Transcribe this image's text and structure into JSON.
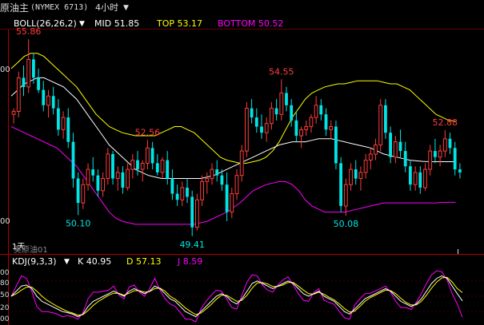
{
  "header": {
    "instrument": "原油主",
    "code": "(NYMEX 6713)",
    "period": "4小时",
    "period_dropdown_icon": "chevron-down-icon"
  },
  "boll_legend": {
    "name": "BOLL(26,26,2)",
    "mid": "MID 51.85",
    "top": "TOP 53.17",
    "bottom": "BOTTOM 50.52",
    "colors": {
      "mid": "#ffffff",
      "top": "#ffff00",
      "bottom": "#ff00ff",
      "name": "#ffffff"
    }
  },
  "kdj_legend": {
    "name": "KDJ(9,3,3)",
    "k": "K 40.95",
    "d": "D 57.13",
    "j": "J 8.59",
    "colors": {
      "k": "#ffffff",
      "d": "#ffff00",
      "j": "#ff00ff"
    }
  },
  "y_axis_labels": {
    "upper": "00",
    "lower": "00"
  },
  "kdj_axis_labels": [
    "00",
    "80",
    "50",
    "20",
    "00"
  ],
  "annotations": [
    {
      "text": "55.86",
      "kind": "high"
    },
    {
      "text": "54.55",
      "kind": "high"
    },
    {
      "text": "52.56",
      "kind": "high"
    },
    {
      "text": "52.88",
      "kind": "high"
    },
    {
      "text": "50.10",
      "kind": "low"
    },
    {
      "text": "49.41",
      "kind": "low"
    },
    {
      "text": "50.08",
      "kind": "low"
    }
  ],
  "footer_label": "1天",
  "contract_tag": "美原油01",
  "colors": {
    "up": "#ff3c3c",
    "down": "#00e5e5",
    "high_label": "#ff3c3c",
    "low_label": "#00e5e5",
    "axis": "#b00000"
  },
  "chart_data": {
    "type": "candlestick",
    "price_range": [
      49.3,
      56.1
    ],
    "candles": [
      [
        53.4,
        53.6,
        53.1,
        53.5
      ],
      [
        53.5,
        54.8,
        53.3,
        54.6
      ],
      [
        54.6,
        55.0,
        54.0,
        54.3
      ],
      [
        54.3,
        55.86,
        54.1,
        55.2
      ],
      [
        55.2,
        55.4,
        54.4,
        54.6
      ],
      [
        54.6,
        54.9,
        54.1,
        54.2
      ],
      [
        54.2,
        54.5,
        53.5,
        53.7
      ],
      [
        53.7,
        54.2,
        53.3,
        54.0
      ],
      [
        54.0,
        54.3,
        53.4,
        53.6
      ],
      [
        53.6,
        53.9,
        52.7,
        52.9
      ],
      [
        52.9,
        53.5,
        52.6,
        53.3
      ],
      [
        53.3,
        53.6,
        52.3,
        52.5
      ],
      [
        52.5,
        52.8,
        51.0,
        51.3
      ],
      [
        51.3,
        51.5,
        50.1,
        50.5
      ],
      [
        50.5,
        51.3,
        50.3,
        51.1
      ],
      [
        51.1,
        51.8,
        50.9,
        51.6
      ],
      [
        51.6,
        52.0,
        51.2,
        51.4
      ],
      [
        51.4,
        51.6,
        50.7,
        50.9
      ],
      [
        50.9,
        51.5,
        50.7,
        51.3
      ],
      [
        51.3,
        52.3,
        51.1,
        52.1
      ],
      [
        52.1,
        52.2,
        51.1,
        51.3
      ],
      [
        51.3,
        51.7,
        50.9,
        51.5
      ],
      [
        51.5,
        51.7,
        50.8,
        51.0
      ],
      [
        51.0,
        51.8,
        50.9,
        51.6
      ],
      [
        51.6,
        52.1,
        51.3,
        51.9
      ],
      [
        51.9,
        52.2,
        51.4,
        51.6
      ],
      [
        51.6,
        51.9,
        51.2,
        51.8
      ],
      [
        51.8,
        52.56,
        51.6,
        52.3
      ],
      [
        52.3,
        52.5,
        51.6,
        51.8
      ],
      [
        51.8,
        52.1,
        51.4,
        51.5
      ],
      [
        51.5,
        52.0,
        51.3,
        51.9
      ],
      [
        51.9,
        52.2,
        51.1,
        51.3
      ],
      [
        51.3,
        51.6,
        50.6,
        50.8
      ],
      [
        50.8,
        51.1,
        50.4,
        50.6
      ],
      [
        50.6,
        51.2,
        50.4,
        51.0
      ],
      [
        51.0,
        51.3,
        50.5,
        50.7
      ],
      [
        50.7,
        50.9,
        49.41,
        49.7
      ],
      [
        49.7,
        50.8,
        49.6,
        50.6
      ],
      [
        50.6,
        51.4,
        50.4,
        51.2
      ],
      [
        51.2,
        51.5,
        50.8,
        51.3
      ],
      [
        51.3,
        51.8,
        51.1,
        51.6
      ],
      [
        51.6,
        51.9,
        51.2,
        51.4
      ],
      [
        51.4,
        51.6,
        50.9,
        51.1
      ],
      [
        51.1,
        51.5,
        49.9,
        50.2
      ],
      [
        50.2,
        51.0,
        50.0,
        50.8
      ],
      [
        50.8,
        51.6,
        50.6,
        51.4
      ],
      [
        51.4,
        52.4,
        51.2,
        52.2
      ],
      [
        52.2,
        53.8,
        52.0,
        53.6
      ],
      [
        53.6,
        53.9,
        53.1,
        53.3
      ],
      [
        53.3,
        53.6,
        52.8,
        53.0
      ],
      [
        53.0,
        53.4,
        52.6,
        52.8
      ],
      [
        52.8,
        53.3,
        52.5,
        53.1
      ],
      [
        53.1,
        53.8,
        52.9,
        53.6
      ],
      [
        53.6,
        53.9,
        53.2,
        53.4
      ],
      [
        53.4,
        54.55,
        53.2,
        54.1
      ],
      [
        54.1,
        54.3,
        53.5,
        53.7
      ],
      [
        53.7,
        53.9,
        53.0,
        53.2
      ],
      [
        53.2,
        53.5,
        52.5,
        52.7
      ],
      [
        52.7,
        53.0,
        52.3,
        52.9
      ],
      [
        52.9,
        53.2,
        52.7,
        53.0
      ],
      [
        53.0,
        53.4,
        52.8,
        53.3
      ],
      [
        53.3,
        54.0,
        53.1,
        53.7
      ],
      [
        53.7,
        53.9,
        53.2,
        53.4
      ],
      [
        53.4,
        53.6,
        52.7,
        52.9
      ],
      [
        52.9,
        53.2,
        52.6,
        53.0
      ],
      [
        53.0,
        53.2,
        51.6,
        51.8
      ],
      [
        51.8,
        52.0,
        50.2,
        50.4
      ],
      [
        50.4,
        51.3,
        50.08,
        51.1
      ],
      [
        51.1,
        51.8,
        50.9,
        51.6
      ],
      [
        51.6,
        51.9,
        51.1,
        51.3
      ],
      [
        51.3,
        51.7,
        50.9,
        51.5
      ],
      [
        51.5,
        52.1,
        51.3,
        51.9
      ],
      [
        51.9,
        52.3,
        51.6,
        52.1
      ],
      [
        52.1,
        52.6,
        51.9,
        52.4
      ],
      [
        52.4,
        53.9,
        52.2,
        53.7
      ],
      [
        53.7,
        53.9,
        52.6,
        52.8
      ],
      [
        52.8,
        53.0,
        51.8,
        52.0
      ],
      [
        52.0,
        52.7,
        51.8,
        52.5
      ],
      [
        52.5,
        52.9,
        52.0,
        52.2
      ],
      [
        52.2,
        52.5,
        51.5,
        51.7
      ],
      [
        51.7,
        51.9,
        50.9,
        51.1
      ],
      [
        51.1,
        51.7,
        50.9,
        51.5
      ],
      [
        51.5,
        51.7,
        50.8,
        51.0
      ],
      [
        51.0,
        51.8,
        50.9,
        51.6
      ],
      [
        51.6,
        52.4,
        51.4,
        52.2
      ],
      [
        52.2,
        52.6,
        51.8,
        52.0
      ],
      [
        52.0,
        52.4,
        51.7,
        52.2
      ],
      [
        52.2,
        52.88,
        52.0,
        52.6
      ],
      [
        52.6,
        52.8,
        52.1,
        52.3
      ],
      [
        52.3,
        52.5,
        51.4,
        51.6
      ],
      [
        51.6,
        51.8,
        51.3,
        51.5
      ]
    ],
    "boll_top": [
      54.9,
      55.1,
      55.3,
      55.4,
      55.4,
      55.3,
      55.1,
      54.9,
      54.7,
      54.5,
      54.3,
      54.0,
      53.7,
      53.4,
      53.2,
      53.0,
      52.9,
      52.8,
      52.75,
      52.7,
      52.7,
      52.7,
      52.7,
      52.8,
      52.9,
      53.0,
      53.0,
      52.9,
      52.8,
      52.6,
      52.4,
      52.2,
      52.0,
      51.9,
      51.85,
      51.8,
      51.8,
      51.85,
      51.9,
      52.0,
      52.2,
      52.5,
      52.9,
      53.3,
      53.6,
      53.9,
      54.1,
      54.2,
      54.3,
      54.35,
      54.4,
      54.4,
      54.45,
      54.5,
      54.5,
      54.5,
      54.5,
      54.45,
      54.4,
      54.4,
      54.3,
      54.2,
      54.0,
      53.8,
      53.6,
      53.4,
      53.3,
      53.2,
      53.17
    ],
    "boll_mid": [
      54.0,
      54.2,
      54.4,
      54.5,
      54.6,
      54.6,
      54.5,
      54.4,
      54.3,
      54.1,
      53.9,
      53.6,
      53.3,
      53.0,
      52.7,
      52.4,
      52.2,
      52.0,
      51.8,
      51.6,
      51.5,
      51.4,
      51.35,
      51.3,
      51.3,
      51.3,
      51.3,
      51.3,
      51.3,
      51.3,
      51.35,
      51.4,
      51.5,
      51.6,
      51.7,
      51.8,
      51.9,
      52.0,
      52.1,
      52.2,
      52.3,
      52.4,
      52.45,
      52.5,
      52.5,
      52.5,
      52.55,
      52.6,
      52.6,
      52.6,
      52.55,
      52.5,
      52.45,
      52.4,
      52.35,
      52.3,
      52.2,
      52.1,
      52.05,
      52.0,
      51.95,
      51.9,
      51.88,
      51.86,
      51.85,
      51.85,
      51.85,
      51.85,
      51.85
    ],
    "boll_bottom": [
      53.0,
      52.9,
      52.8,
      52.7,
      52.6,
      52.5,
      52.4,
      52.3,
      52.1,
      51.9,
      51.7,
      51.4,
      51.1,
      50.8,
      50.5,
      50.2,
      50.0,
      49.9,
      49.85,
      49.8,
      49.8,
      49.8,
      49.8,
      49.8,
      49.8,
      49.8,
      49.8,
      49.8,
      49.8,
      49.85,
      49.9,
      50.0,
      50.1,
      50.2,
      50.35,
      50.5,
      50.7,
      50.9,
      51.0,
      51.1,
      51.15,
      51.2,
      51.2,
      51.1,
      50.9,
      50.6,
      50.4,
      50.3,
      50.2,
      50.2,
      50.2,
      50.2,
      50.25,
      50.3,
      50.35,
      50.4,
      50.45,
      50.5,
      50.5,
      50.5,
      50.5,
      50.5,
      50.5,
      50.5,
      50.5,
      50.5,
      50.52,
      50.52,
      50.52
    ],
    "kdj_k": [
      50,
      60,
      70,
      72,
      65,
      50,
      40,
      35,
      30,
      25,
      20,
      18,
      15,
      10,
      15,
      30,
      40,
      45,
      50,
      55,
      60,
      55,
      50,
      60,
      65,
      60,
      55,
      60,
      70,
      65,
      55,
      45,
      40,
      30,
      20,
      15,
      10,
      20,
      30,
      40,
      50,
      55,
      50,
      40,
      35,
      45,
      60,
      75,
      80,
      75,
      70,
      65,
      70,
      75,
      80,
      75,
      65,
      55,
      50,
      55,
      60,
      50,
      45,
      40,
      30,
      20,
      15,
      25,
      35,
      45,
      50,
      55,
      60,
      65,
      60,
      50,
      40,
      35,
      30,
      35,
      45,
      60,
      75,
      85,
      90,
      85,
      70,
      55,
      40.95
    ],
    "kdj_d": [
      50,
      55,
      62,
      68,
      68,
      60,
      50,
      42,
      36,
      30,
      25,
      20,
      17,
      13,
      14,
      22,
      32,
      40,
      46,
      52,
      56,
      56,
      52,
      56,
      61,
      61,
      58,
      59,
      65,
      66,
      60,
      50,
      44,
      36,
      27,
      20,
      14,
      17,
      25,
      34,
      44,
      52,
      52,
      46,
      40,
      42,
      52,
      66,
      76,
      77,
      74,
      69,
      69,
      72,
      77,
      77,
      70,
      62,
      55,
      54,
      58,
      54,
      48,
      43,
      35,
      26,
      19,
      21,
      30,
      40,
      47,
      52,
      57,
      62,
      61,
      55,
      46,
      38,
      33,
      33,
      40,
      52,
      66,
      78,
      86,
      87,
      78,
      65,
      57.13
    ],
    "kdj_j": [
      50,
      70,
      90,
      85,
      60,
      30,
      20,
      20,
      18,
      15,
      10,
      12,
      10,
      5,
      18,
      45,
      58,
      58,
      60,
      62,
      70,
      52,
      45,
      68,
      72,
      58,
      50,
      65,
      85,
      62,
      45,
      35,
      30,
      18,
      5,
      5,
      0,
      25,
      40,
      52,
      62,
      60,
      45,
      28,
      25,
      52,
      78,
      92,
      90,
      72,
      62,
      58,
      72,
      82,
      88,
      72,
      55,
      42,
      40,
      57,
      65,
      42,
      38,
      34,
      20,
      8,
      5,
      33,
      45,
      55,
      56,
      60,
      65,
      70,
      58,
      40,
      28,
      28,
      24,
      38,
      55,
      75,
      92,
      100,
      98,
      82,
      55,
      35,
      8.59
    ]
  }
}
